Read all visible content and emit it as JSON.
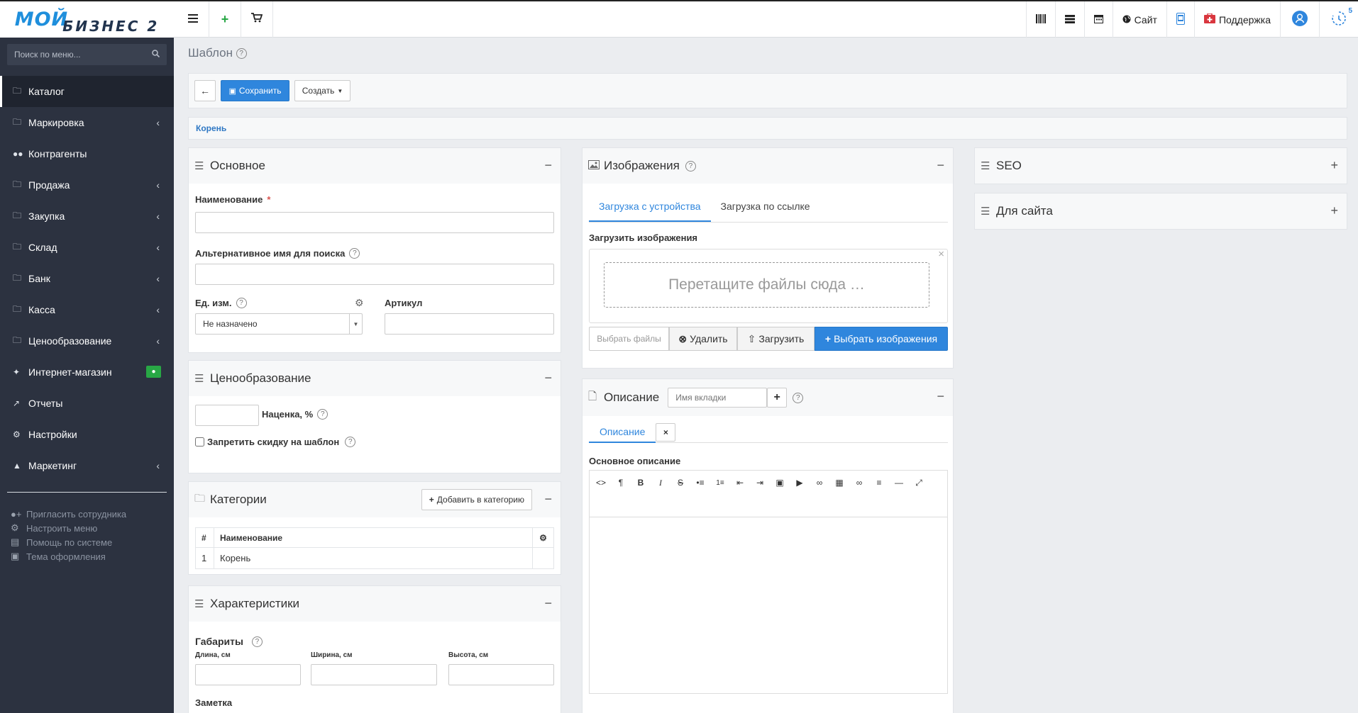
{
  "logo": {
    "line1": "МОЙ",
    "line2": "БИЗНЕС 2"
  },
  "topbar": {
    "site_label": "Сайт",
    "support_label": "Поддержка",
    "notif_count": "5"
  },
  "sidebar": {
    "search_placeholder": "Поиск по меню...",
    "items": [
      {
        "label": "Каталог"
      },
      {
        "label": "Маркировка"
      },
      {
        "label": "Контрагенты"
      },
      {
        "label": "Продажа"
      },
      {
        "label": "Закупка"
      },
      {
        "label": "Склад"
      },
      {
        "label": "Банк"
      },
      {
        "label": "Касса"
      },
      {
        "label": "Ценообразование"
      },
      {
        "label": "Интернет-магазин"
      },
      {
        "label": "Отчеты"
      },
      {
        "label": "Настройки"
      },
      {
        "label": "Маркетинг"
      }
    ],
    "links": [
      {
        "label": "Пригласить сотрудника"
      },
      {
        "label": "Настроить меню"
      },
      {
        "label": "Помощь по системе"
      },
      {
        "label": "Тема оформления"
      }
    ]
  },
  "page": {
    "title": "Шаблон"
  },
  "toolbar": {
    "save_label": "Сохранить",
    "create_label": "Создать"
  },
  "breadcrumb": {
    "root": "Корень"
  },
  "basic": {
    "title": "Основное",
    "name_label": "Наименование",
    "name_req": "*",
    "alt_label": "Альтернативное имя для поиска",
    "unit_label": "Ед. изм.",
    "unit_value": "Не назначено",
    "sku_label": "Артикул"
  },
  "pricing": {
    "title": "Ценообразование",
    "markup_label": "Наценка, %",
    "nodiscount_label": "Запретить скидку на шаблон"
  },
  "categories": {
    "title": "Категории",
    "add_label": "Добавить в категорию",
    "col_num": "#",
    "col_name": "Наименование",
    "rows": [
      {
        "num": "1",
        "name": "Корень"
      }
    ]
  },
  "chars": {
    "title": "Характеристики",
    "dims_label": "Габариты",
    "length_label": "Длина, см",
    "width_label": "Ширина, см",
    "height_label": "Высота, см",
    "note_label": "Заметка"
  },
  "images": {
    "title": "Изображения",
    "tab_device": "Загрузка с устройства",
    "tab_link": "Загрузка по ссылке",
    "upload_label": "Загрузить изображения",
    "drop_text": "Перетащите файлы сюда …",
    "choose_files": "Выбрать файлы",
    "delete_label": "Удалить",
    "upload_btn": "Загрузить",
    "select_images": "Выбрать изображения"
  },
  "description": {
    "title": "Описание",
    "tab_placeholder": "Имя вкладки",
    "tab_label": "Описание",
    "main_label": "Основное описание"
  },
  "seo": {
    "title": "SEO"
  },
  "forsite": {
    "title": "Для сайта"
  }
}
